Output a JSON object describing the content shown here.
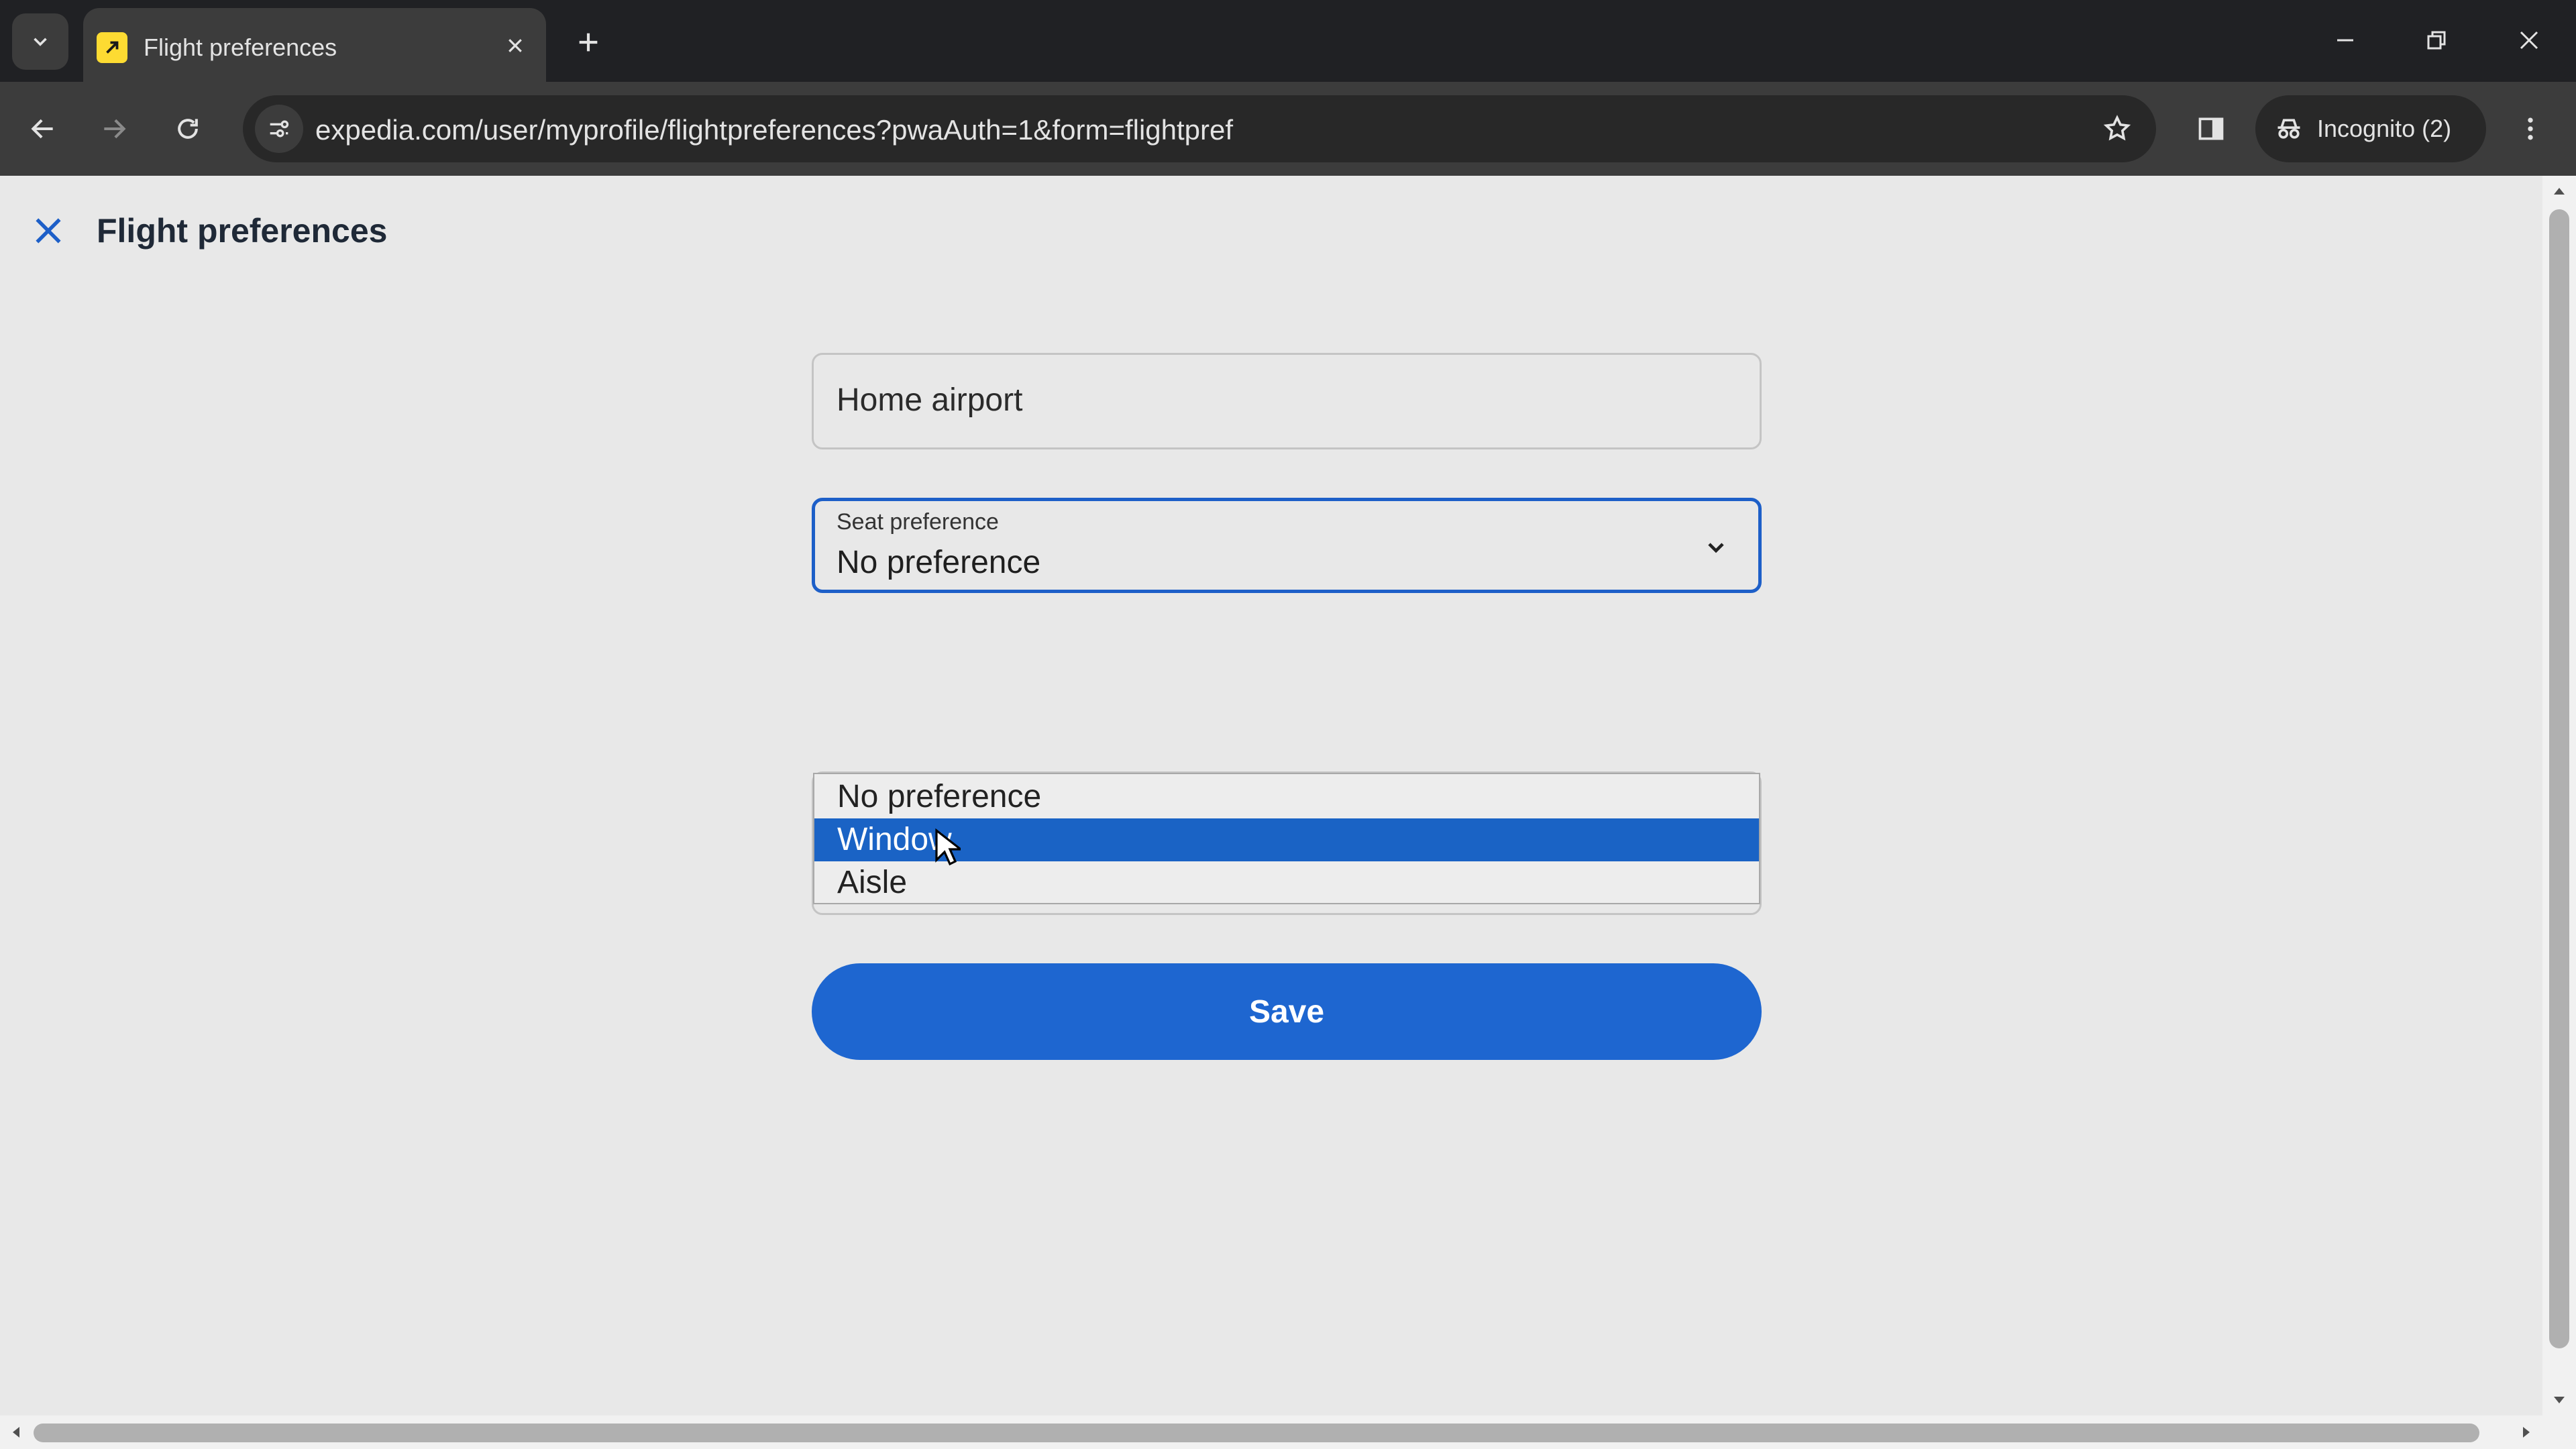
{
  "browser": {
    "tab_title": "Flight preferences",
    "url": "expedia.com/user/myprofile/flightpreferences?pwaAuth=1&form=flightpref",
    "incognito_label": "Incognito (2)"
  },
  "page": {
    "title": "Flight preferences",
    "home_airport": {
      "placeholder": "Home airport"
    },
    "seat_preference": {
      "label": "Seat preference",
      "value": "No preference",
      "options": [
        "No preference",
        "Window",
        "Aisle"
      ],
      "highlighted": "Window"
    },
    "save_label": "Save"
  },
  "colors": {
    "accent": "#1e66d0",
    "option_highlight": "#1a63c5",
    "favicon": "#fddb32"
  },
  "icons": [
    "tab-search-icon",
    "expedia-favicon-icon",
    "close-icon",
    "plus-icon",
    "minimize-icon",
    "restore-icon",
    "back-icon",
    "forward-icon",
    "reload-icon",
    "site-settings-icon",
    "star-icon",
    "side-panel-icon",
    "incognito-icon",
    "more-icon",
    "chevron-down-icon",
    "cursor-icon"
  ]
}
